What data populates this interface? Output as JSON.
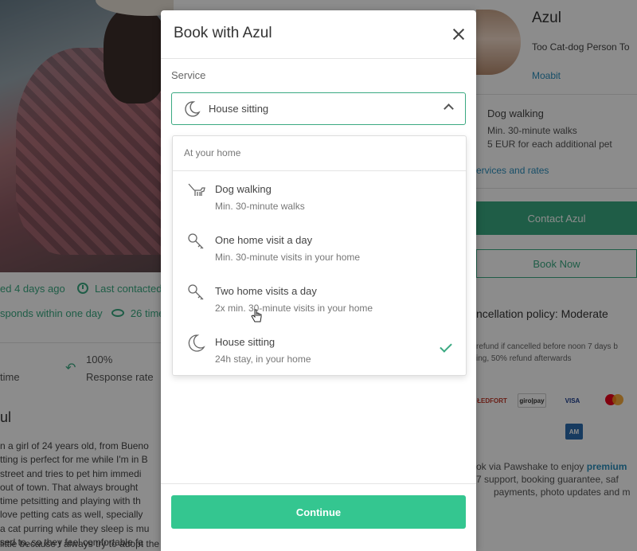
{
  "background": {
    "profile_meta": {
      "updated": "ed 4 days ago",
      "last_contacted": "Last contacted",
      "responds": "sponds within one day",
      "views": "26 time"
    },
    "stats": {
      "stat_a_label": "time",
      "response_value": "100%",
      "response_label": "Response rate"
    },
    "about": {
      "title": "ul",
      "lines": [
        "n a girl of 24 years old, from Bueno",
        "tting is perfect for me while I'm in B",
        "street and tries to pet him immedi",
        "out of town. That always brought",
        "time petsitting and playing with th",
        "love petting cats as well, specially",
        "a cat purring while they sleep is mu",
        "sed to, so they feel comfortable fa"
      ],
      "bottom_line": "little because I always try to adopt the ones I found on the streets! Nothing but love and"
    },
    "sitter": {
      "name": "Azul",
      "tagline": "Too Cat-dog Person To",
      "location": "Moabit",
      "service_name": "Dog walking",
      "service_min": "Min. 30-minute walks",
      "service_extra": "5 EUR for each additional pet",
      "services_link": "ervices and rates",
      "contact_label": "Contact Azul",
      "book_label": "Book Now",
      "policy_title": "ncellation policy: Moderate",
      "policy_line1": "refund if cancelled before noon 7 days b",
      "policy_line2": "ing, 50% refund afterwards",
      "payment_methods": [
        "postfinance",
        "giropay",
        "VISA",
        "mastercard",
        "amex"
      ],
      "premium_line1_pre": "ok via Pawshake to enjoy ",
      "premium_link": "premium",
      "premium_line2": "7 support, booking guarantee, saf",
      "premium_line3": "payments, photo updates and m"
    }
  },
  "modal": {
    "title": "Book with Azul",
    "close_icon": "close-icon",
    "service_label": "Service",
    "selected_service": "House sitting",
    "selected_icon": "moon-icon",
    "dropdown": {
      "group_label": "At your home",
      "options": [
        {
          "title": "Dog walking",
          "subtitle": "Min. 30-minute walks",
          "icon": "dog-walk-icon",
          "selected": false
        },
        {
          "title": "One home visit a day",
          "subtitle": "Min. 30-minute visits in your home",
          "icon": "key-icon",
          "selected": false
        },
        {
          "title": "Two home visits a day",
          "subtitle": "2x min. 30-minute visits in your home",
          "icon": "key-icon",
          "selected": false
        },
        {
          "title": "House sitting",
          "subtitle": "24h stay, in your home",
          "icon": "moon-icon",
          "selected": true
        }
      ]
    },
    "continue_label": "Continue"
  },
  "colors": {
    "accent": "#34c690",
    "accent_dark": "#3aa981",
    "link": "#2a8fbd"
  }
}
